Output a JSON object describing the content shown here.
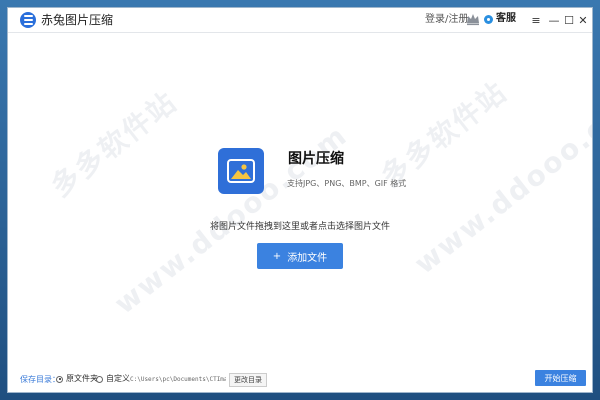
{
  "app": {
    "title": "赤兔图片压缩",
    "login_label": "登录/注册",
    "service_label": "客服",
    "controls": {
      "menu": "≡",
      "minimize": "—",
      "maximize": "☐",
      "close": "✕"
    }
  },
  "main": {
    "heading": "图片压缩",
    "formats": "支持JPG、PNG、BMP、GIF 格式",
    "drag_hint": "将图片文件拖拽到这里或者点击选择图片文件",
    "add_button_plus": "+",
    "add_button": "添加文件"
  },
  "bottom": {
    "save_label": "保存目录：",
    "options": [
      "原文件夹",
      "自定义"
    ],
    "selected_option": "原文件夹",
    "path": "C:\\Users\\pc\\Documents\\CTImageC",
    "change_button": "更改目录",
    "start_button": "开始压缩"
  },
  "colors": {
    "accent": "#3b82e0",
    "icon_bg": "#2f6fd8",
    "save_label": "#3b7bd8"
  }
}
